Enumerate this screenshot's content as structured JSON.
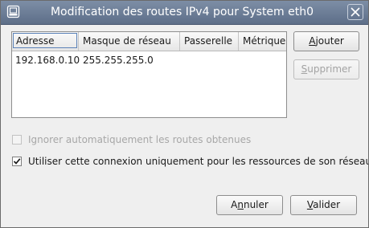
{
  "window": {
    "title": "Modification des routes IPv4 pour System eth0",
    "app_icon": "window-menu-icon",
    "close_icon": "close-icon",
    "titlebar_color": "#6a7b94"
  },
  "routes_table": {
    "columns": [
      "Adresse",
      "Masque de réseau",
      "Passerelle",
      "Métrique"
    ],
    "rows": [
      [
        "192.168.0.10",
        "255.255.255.0",
        "",
        ""
      ]
    ]
  },
  "side_buttons": {
    "add": {
      "before": "",
      "mnemonic": "A",
      "after": "jouter"
    },
    "delete": {
      "before": "",
      "mnemonic": "S",
      "after": "upprimer",
      "disabled": true
    }
  },
  "options": {
    "ignore_auto_routes": {
      "label": "Ignorer automatiquement les routes obtenues",
      "checked": false,
      "disabled": true
    },
    "only_network_resources": {
      "label": "Utiliser cette connexion uniquement pour les ressources de son réseau",
      "checked": true,
      "disabled": false
    }
  },
  "dialog_buttons": {
    "cancel": {
      "before": "A",
      "mnemonic": "n",
      "after": "nuler"
    },
    "ok": {
      "before": "",
      "mnemonic": "V",
      "after": "alider"
    }
  }
}
